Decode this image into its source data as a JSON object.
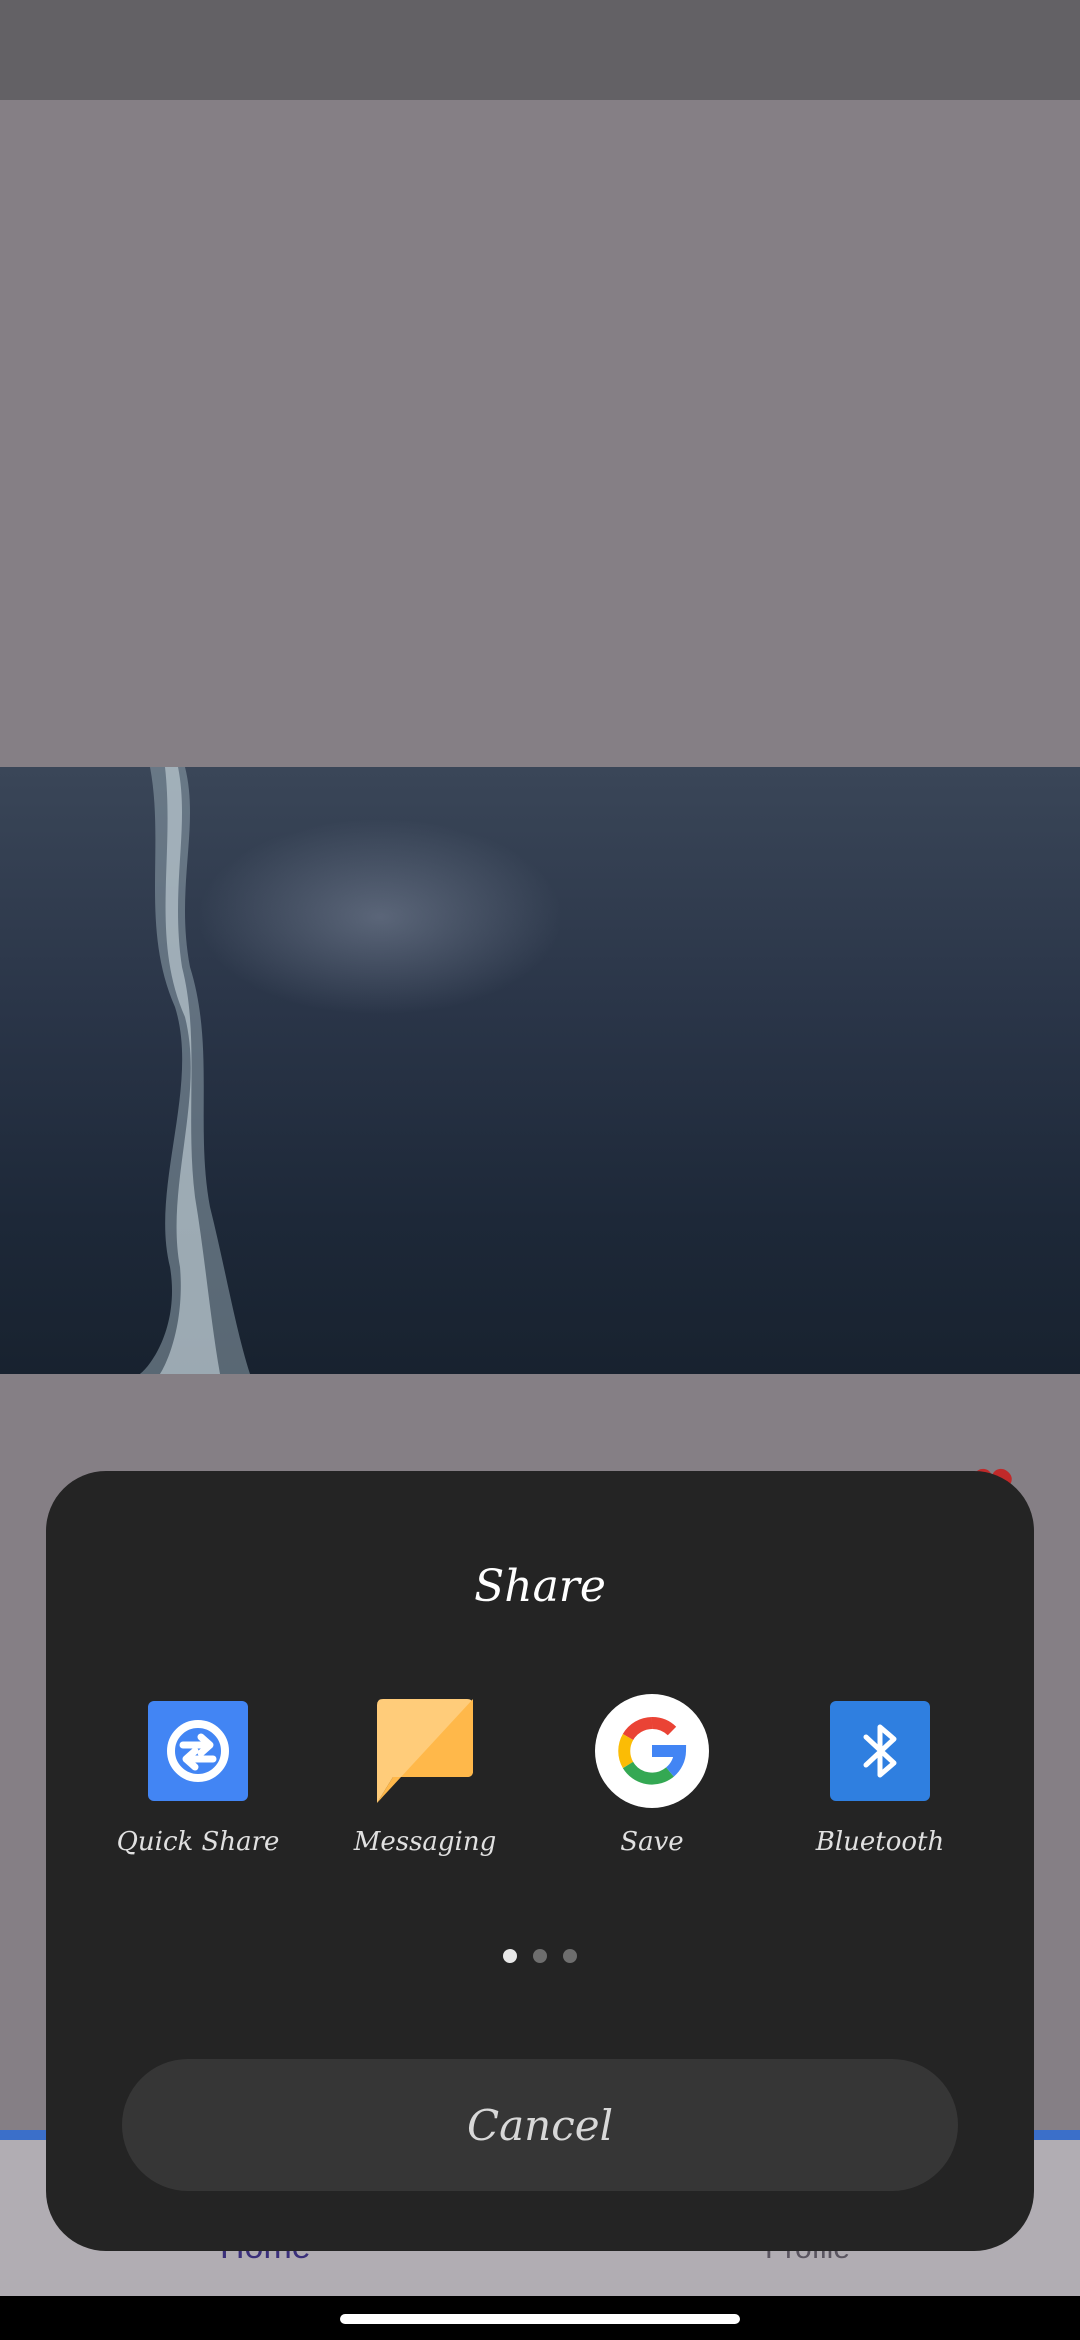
{
  "bottom_nav": {
    "home_label": "Home",
    "profile_label": "Profile",
    "accent_color": "#3b6fc9"
  },
  "share_sheet": {
    "title": "Share",
    "targets": [
      {
        "label": "Quick Share",
        "icon": "quick-share-icon",
        "color": "#4285f4"
      },
      {
        "label": "Messaging",
        "icon": "messaging-icon",
        "color": "#ffc466"
      },
      {
        "label": "Save",
        "icon": "google-save-icon",
        "color": "#ffffff"
      },
      {
        "label": "Bluetooth",
        "icon": "bluetooth-icon",
        "color": "#2f7fe0"
      }
    ],
    "page_indicator": {
      "pages": 3,
      "current": 1
    },
    "cancel_label": "Cancel"
  }
}
